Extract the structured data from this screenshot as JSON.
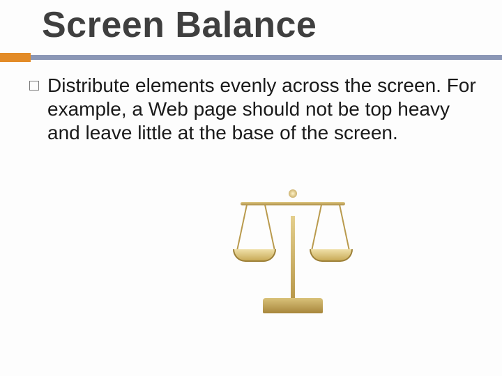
{
  "title": "Screen Balance",
  "body_text": "Distribute elements evenly across the screen. For example, a Web page should not be top heavy and leave little at the base of the screen.",
  "colors": {
    "accent": "#e38b27",
    "rule": "#8b97b6",
    "title": "#3f3f3f"
  },
  "illustration": "balance-scale"
}
